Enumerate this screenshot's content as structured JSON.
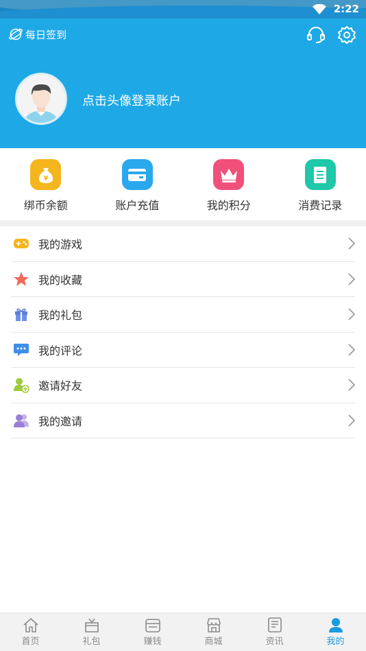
{
  "status_bar": {
    "time": "2:22"
  },
  "header": {
    "checkin_label": "每日签到",
    "login_prompt": "点击头像登录账户"
  },
  "quick_actions": [
    {
      "label": "绑币余额",
      "icon": "money-bag-icon",
      "color": "#f5b51d"
    },
    {
      "label": "账户充值",
      "icon": "card-icon",
      "color": "#2aa8ee"
    },
    {
      "label": "我的积分",
      "icon": "crown-icon",
      "color": "#f0507a"
    },
    {
      "label": "消费记录",
      "icon": "record-icon",
      "color": "#1ec8a8"
    }
  ],
  "menu": [
    {
      "label": "我的游戏",
      "icon": "gamepad-icon"
    },
    {
      "label": "我的收藏",
      "icon": "star-icon"
    },
    {
      "label": "我的礼包",
      "icon": "gift-icon"
    },
    {
      "label": "我的评论",
      "icon": "comment-icon"
    },
    {
      "label": "邀请好友",
      "icon": "add-friend-icon"
    },
    {
      "label": "我的邀请",
      "icon": "invite-icon"
    }
  ],
  "tabs": [
    {
      "label": "首页",
      "icon": "home-icon",
      "active": false
    },
    {
      "label": "礼包",
      "icon": "gift-box-icon",
      "active": false
    },
    {
      "label": "赚钱",
      "icon": "earn-icon",
      "active": false
    },
    {
      "label": "商城",
      "icon": "store-icon",
      "active": false
    },
    {
      "label": "资讯",
      "icon": "news-icon",
      "active": false
    },
    {
      "label": "我的",
      "icon": "profile-icon",
      "active": true
    }
  ],
  "colors": {
    "header_bg": "#1ea9e6",
    "accent": "#1a9be0"
  }
}
